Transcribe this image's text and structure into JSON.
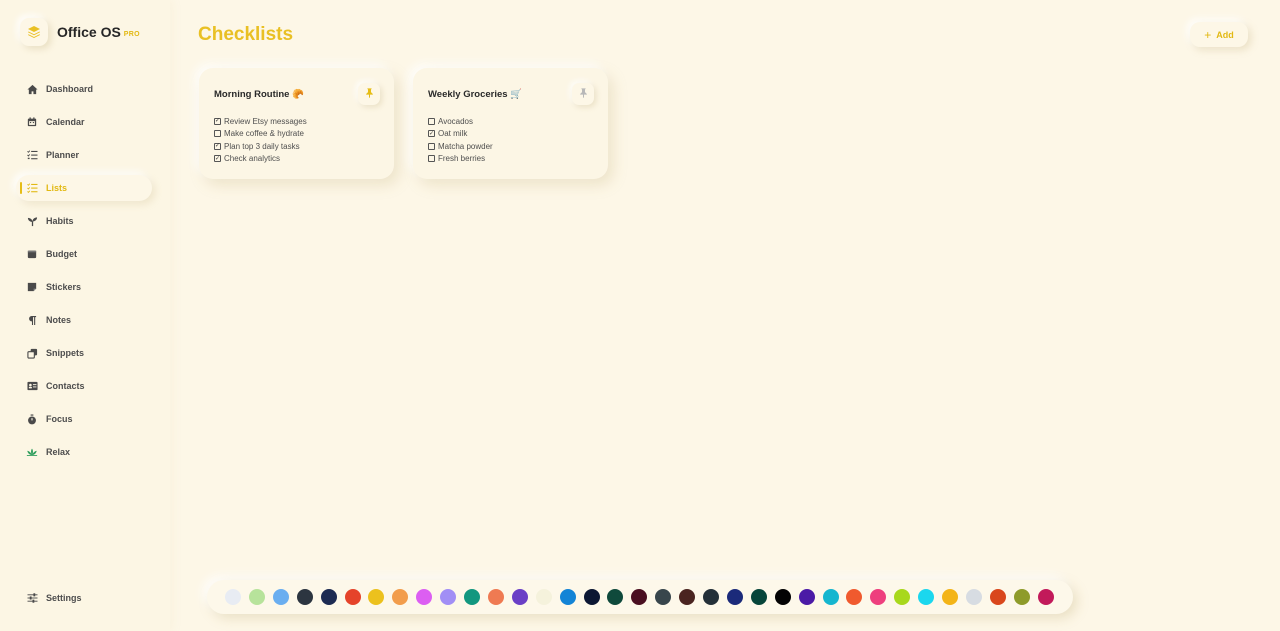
{
  "brand": {
    "name": "Office OS",
    "badge": "PRO"
  },
  "nav": [
    {
      "label": "Dashboard",
      "icon": "home-icon"
    },
    {
      "label": "Calendar",
      "icon": "calendar-icon"
    },
    {
      "label": "Planner",
      "icon": "planner-icon"
    },
    {
      "label": "Lists",
      "icon": "list-icon",
      "active": true
    },
    {
      "label": "Habits",
      "icon": "sprout-icon"
    },
    {
      "label": "Budget",
      "icon": "wallet-icon"
    },
    {
      "label": "Stickers",
      "icon": "sticker-icon"
    },
    {
      "label": "Notes",
      "icon": "pilcrow-icon"
    },
    {
      "label": "Snippets",
      "icon": "copy-icon"
    },
    {
      "label": "Contacts",
      "icon": "id-card-icon"
    },
    {
      "label": "Focus",
      "icon": "timer-icon"
    },
    {
      "label": "Relax",
      "icon": "lotus-icon"
    }
  ],
  "settings": {
    "label": "Settings",
    "icon": "sliders-icon"
  },
  "page": {
    "title": "Checklists"
  },
  "add_button": {
    "label": "Add"
  },
  "cards": [
    {
      "title": "Morning Routine",
      "emoji": "🥐",
      "pinned": true,
      "items": [
        {
          "text": "Review Etsy messages",
          "checked": true
        },
        {
          "text": "Make coffee & hydrate",
          "checked": false
        },
        {
          "text": "Plan top 3 daily tasks",
          "checked": true
        },
        {
          "text": "Check analytics",
          "checked": true
        }
      ]
    },
    {
      "title": "Weekly Groceries",
      "emoji": "🛒",
      "pinned": false,
      "items": [
        {
          "text": "Avocados",
          "checked": false
        },
        {
          "text": "Oat milk",
          "checked": true
        },
        {
          "text": "Matcha powder",
          "checked": false
        },
        {
          "text": "Fresh berries",
          "checked": false
        }
      ]
    }
  ],
  "colors": {
    "accent": "#e9c024",
    "pin_active": "#e6bd16",
    "pin_inactive": "#b8b8b8"
  },
  "palette": [
    "#e8ecf3",
    "#b7e39b",
    "#6aaef0",
    "#2c3540",
    "#1d2b52",
    "#e5432a",
    "#ecc11d",
    "#f29d4c",
    "#dc5ef2",
    "#a18ef5",
    "#12977f",
    "#ef7a52",
    "#6a3fc6",
    "#f5f2dc",
    "#1384d6",
    "#0c1733",
    "#0f4a3c",
    "#4a0f21",
    "#38464c",
    "#4a2420",
    "#243038",
    "#1b2a7a",
    "#07453a",
    "#030303",
    "#4b1aa6",
    "#15b6cf",
    "#f05a2e",
    "#ee3f7e",
    "#a8d81c",
    "#1bd7ee",
    "#f3b418",
    "#d7dce2",
    "#d9471c",
    "#8e9b2a",
    "#c21a5a"
  ]
}
